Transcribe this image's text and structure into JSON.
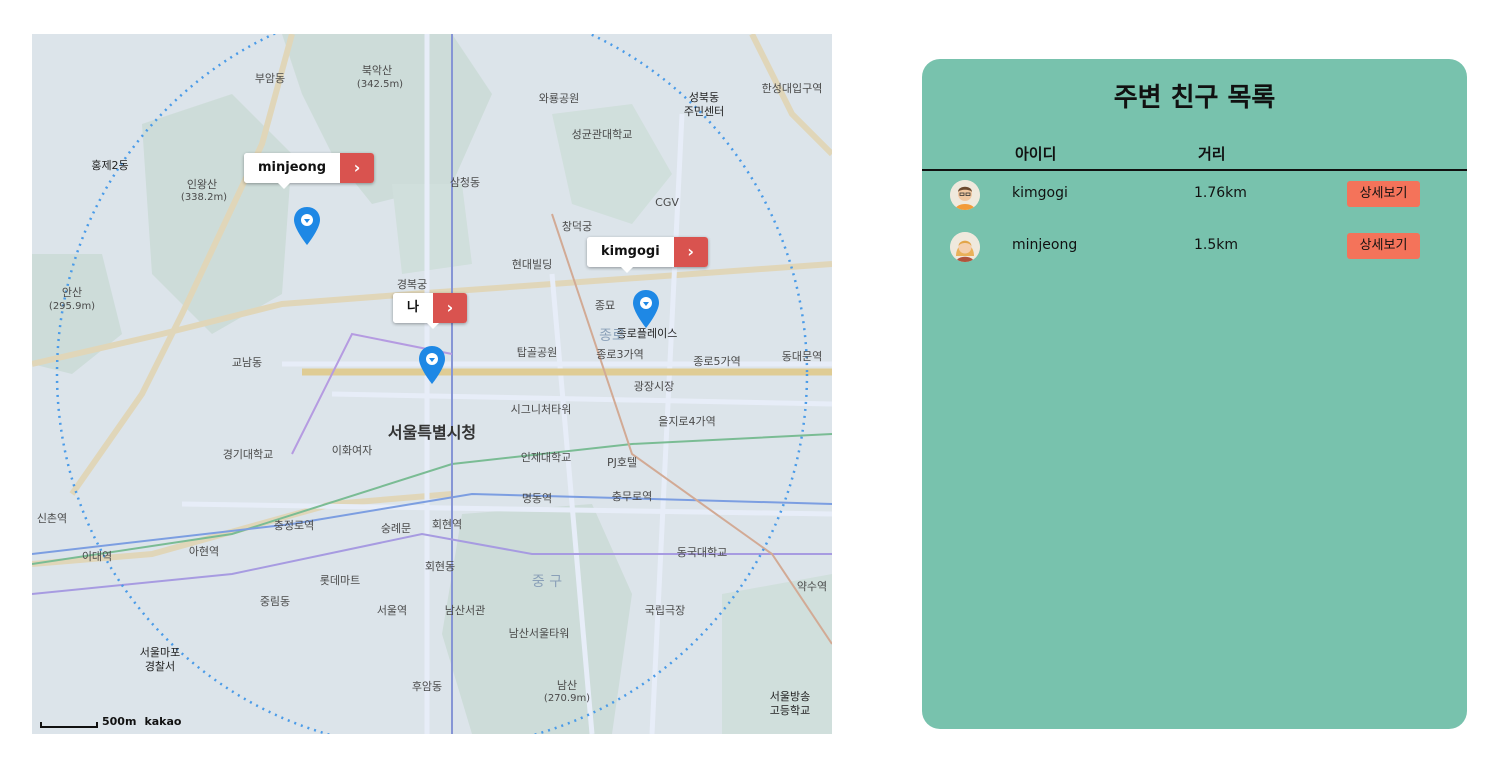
{
  "map": {
    "callouts": [
      {
        "name": "minjeong",
        "arrow": "›"
      },
      {
        "name": "kimgogi",
        "arrow": "›"
      },
      {
        "name": "나",
        "arrow": "›"
      }
    ],
    "labels": {
      "city_hall": "서울특별시청",
      "bukaksan": "북악산",
      "bukaksan_h": "(342.5m)",
      "inwangsan": "인왕산",
      "inwangsan_h": "(338.2m)",
      "namsan": "남산",
      "namsan_h": "(270.9m)",
      "ansan": "안산",
      "ansan_h": "(295.9m)",
      "gyeongbokgung": "경복궁",
      "changdeokgung": "창덕궁",
      "jongmyo": "종묘",
      "jongno3ga": "종로3가역",
      "jongno5ga": "종로5가역",
      "euljiro4ga": "을지로4가역",
      "dongdaemun": "동대문역",
      "seoul_station": "서울역",
      "chungmuro": "충무로역",
      "chungjeongno": "충정로역",
      "myeongdong": "명동역",
      "hoehyeon": "회현역",
      "ahyeon": "아현역",
      "idae": "이대역",
      "yaksu": "약수역",
      "sinchon": "신촌역",
      "hyehwa": "한성대입구역",
      "gwangjang": "광장시장",
      "jongno_place": "종로플레이스",
      "sungnyemun": "숭례문",
      "lotte_mart": "롯데마트",
      "hyundai": "현대빌딩",
      "cgv": "CGV",
      "pj_hotel": "PJ호텔",
      "seongbuk": "성북동",
      "seongbuk2": "주민센터",
      "sungkyunkwan": "성균관대학교",
      "buam": "부암동",
      "samcheong": "삼청동",
      "hongje": "홍제2동",
      "gyonam": "교남동",
      "junglim": "중림동",
      "hoehyeondong": "회현동",
      "huam": "후암동",
      "sobang": "서울방송",
      "sobang2": "고등학교",
      "mapo": "서울마포",
      "mapo2": "경찰서",
      "tapgol": "탑골공원",
      "waryong": "와룡공원",
      "daejeon": "인제대학교",
      "nandaemun": "남산서관",
      "dongguk": "동국대학교",
      "gukrip": "국립극장",
      "sigeunicher": "시그니처타워",
      "namsan_tower": "남산서울타워",
      "ewha": "이화여자",
      "kyunggi": "경기대학교",
      "jongnogu": "종로",
      "junggu": "중 구"
    },
    "scale": {
      "distance": "500m",
      "brand": "kakao"
    }
  },
  "panel": {
    "title": "주변 친구 목록",
    "headers": {
      "id": "아이디",
      "distance": "거리"
    },
    "rows": [
      {
        "id": "kimgogi",
        "distance": "1.76km",
        "button": "상세보기"
      },
      {
        "id": "minjeong",
        "distance": "1.5km",
        "button": "상세보기"
      }
    ]
  },
  "colors": {
    "panel_bg": "#78c2ad",
    "button_bg": "#f4735a",
    "callout_arrow": "#d9534f",
    "pin": "#1e88e5",
    "radius_circle": "#4a9be8"
  }
}
